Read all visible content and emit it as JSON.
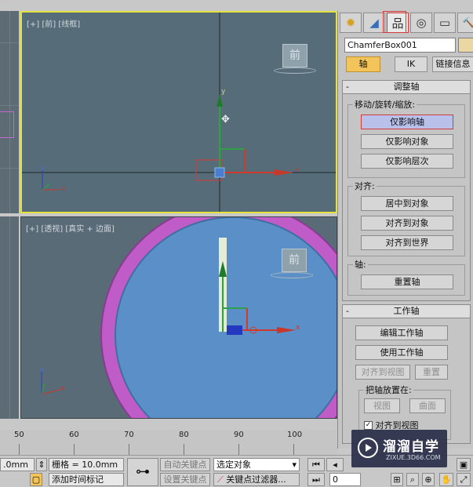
{
  "viewports": {
    "front": {
      "label": "[+] [前] [线框]",
      "viewcube": "前"
    },
    "perspective": {
      "label": "[+] [透视] [真实 + 边面]",
      "viewcube": "前"
    },
    "axis_labels": {
      "x": "x",
      "y": "y",
      "z": "z"
    }
  },
  "command_panel": {
    "tabs": [
      {
        "icon": "create-icon",
        "glyph": "✹"
      },
      {
        "icon": "modify-icon",
        "glyph": "◢"
      },
      {
        "icon": "hierarchy-icon",
        "glyph": "品",
        "active": true
      },
      {
        "icon": "motion-icon",
        "glyph": "◎"
      },
      {
        "icon": "display-icon",
        "glyph": "▭"
      },
      {
        "icon": "utilities-icon",
        "glyph": "🔨"
      }
    ],
    "object_name": "ChamferBox001",
    "subtabs": {
      "pivot": "轴",
      "ik": "IK",
      "link": "链接信息"
    },
    "adjust_pivot": {
      "title": "调整轴",
      "move_group": {
        "title": "移动/旋转/缩放:",
        "affect_pivot_only": "仅影响轴",
        "affect_object_only": "仅影响对象",
        "affect_hierarchy_only": "仅影响层次"
      },
      "align_group": {
        "title": "对齐:",
        "center_to_object": "居中到对象",
        "align_to_object": "对齐到对象",
        "align_to_world": "对齐到世界"
      },
      "pivot_group": {
        "title": "轴:",
        "reset_pivot": "重置轴"
      }
    },
    "working_pivot": {
      "title": "工作轴",
      "edit_working_pivot": "编辑工作轴",
      "use_working_pivot": "使用工作轴",
      "align_to_view": "对齐到视图",
      "reset": "重置",
      "place_pivot_to": "把轴放置在:",
      "view": "视图",
      "surface": "曲面",
      "align_to_view_check": "对齐到视图"
    }
  },
  "timeline": {
    "ticks": [
      "50",
      "60",
      "70",
      "80",
      "90",
      "100"
    ]
  },
  "status_bar": {
    "coord_value": ".0mm",
    "grid": "栅格 = 10.0mm",
    "add_time_tag": "添加时间标记",
    "auto_key": "自动关键点",
    "set_key": "设置关键点",
    "selection_dropdown": "选定对象",
    "key_filters": "关键点过滤器...",
    "frame_value": "0"
  },
  "watermark": {
    "brand": "溜溜自学",
    "url": "ZIXUE.3D66.COM"
  },
  "colors": {
    "selected_viewport_border": "#e6e23c",
    "accent_red": "#d43a3a",
    "active_subtab": "#f2c45a"
  }
}
